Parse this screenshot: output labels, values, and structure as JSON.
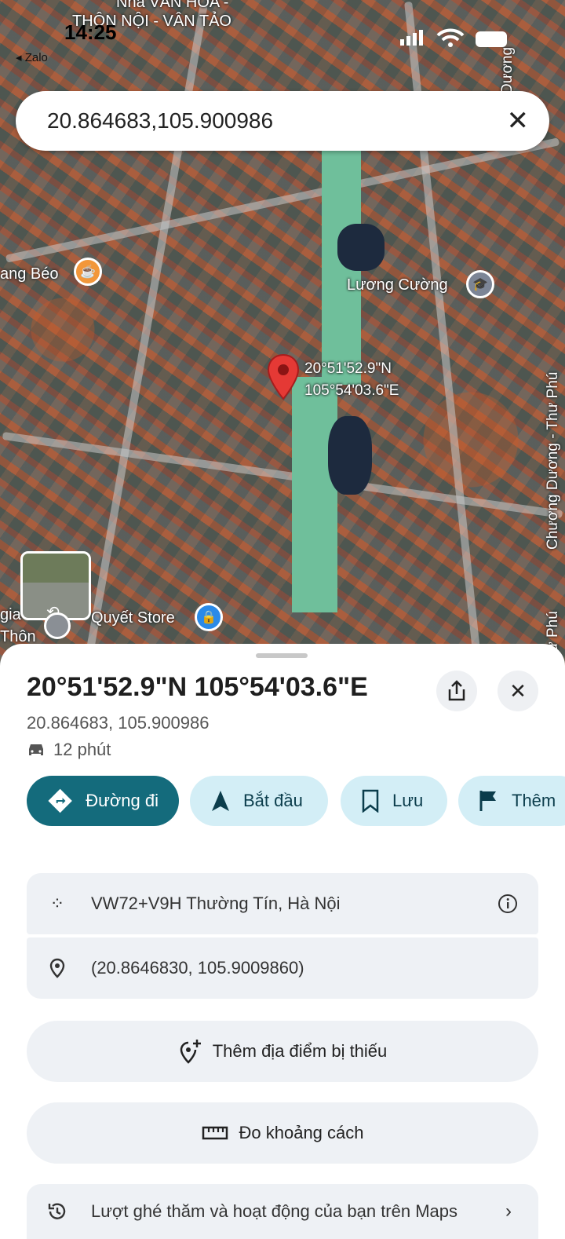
{
  "status_bar": {
    "time": "14:25",
    "back_app": "◂ Zalo"
  },
  "search": {
    "query": "20.864683,105.900986"
  },
  "map": {
    "labels": {
      "nha_van_hoa": "Nhà VĂN HÓA -",
      "thon_noi": "THÔN NỘI - VÂN TẢO",
      "ang_beo": "ang Béo",
      "luong_cuong": "Lương Cường",
      "quyet_store": "Quyết Store",
      "gia_thon_1": "gia",
      "gia_thon_2": "Thôn",
      "duong_top": "Dương",
      "chuong_duong": "Chương Dương - Thư Phú",
      "thu_phu": "ư Phú"
    },
    "pin_label_lat": "20°51'52.9\"N",
    "pin_label_lng": "105°54'03.6\"E"
  },
  "place": {
    "title": "20°51'52.9\"N 105°54'03.6\"E",
    "decimal": "20.864683, 105.900986",
    "eta": "12 phút"
  },
  "actions": {
    "directions": "Đường đi",
    "start": "Bắt đầu",
    "save": "Lưu",
    "more": "Thêm"
  },
  "details": {
    "plus_code": "VW72+V9H Thường Tín, Hà Nội",
    "coords": "(20.8646830, 105.9009860)"
  },
  "buttons": {
    "add_missing": "Thêm địa điểm bị thiếu",
    "measure": "Đo khoảng cách",
    "activity": "Lượt ghé thăm và hoạt động của bạn trên Maps"
  },
  "colors": {
    "primary": "#146b7c",
    "pill": "#d3eef6",
    "pin": "#e53935"
  }
}
